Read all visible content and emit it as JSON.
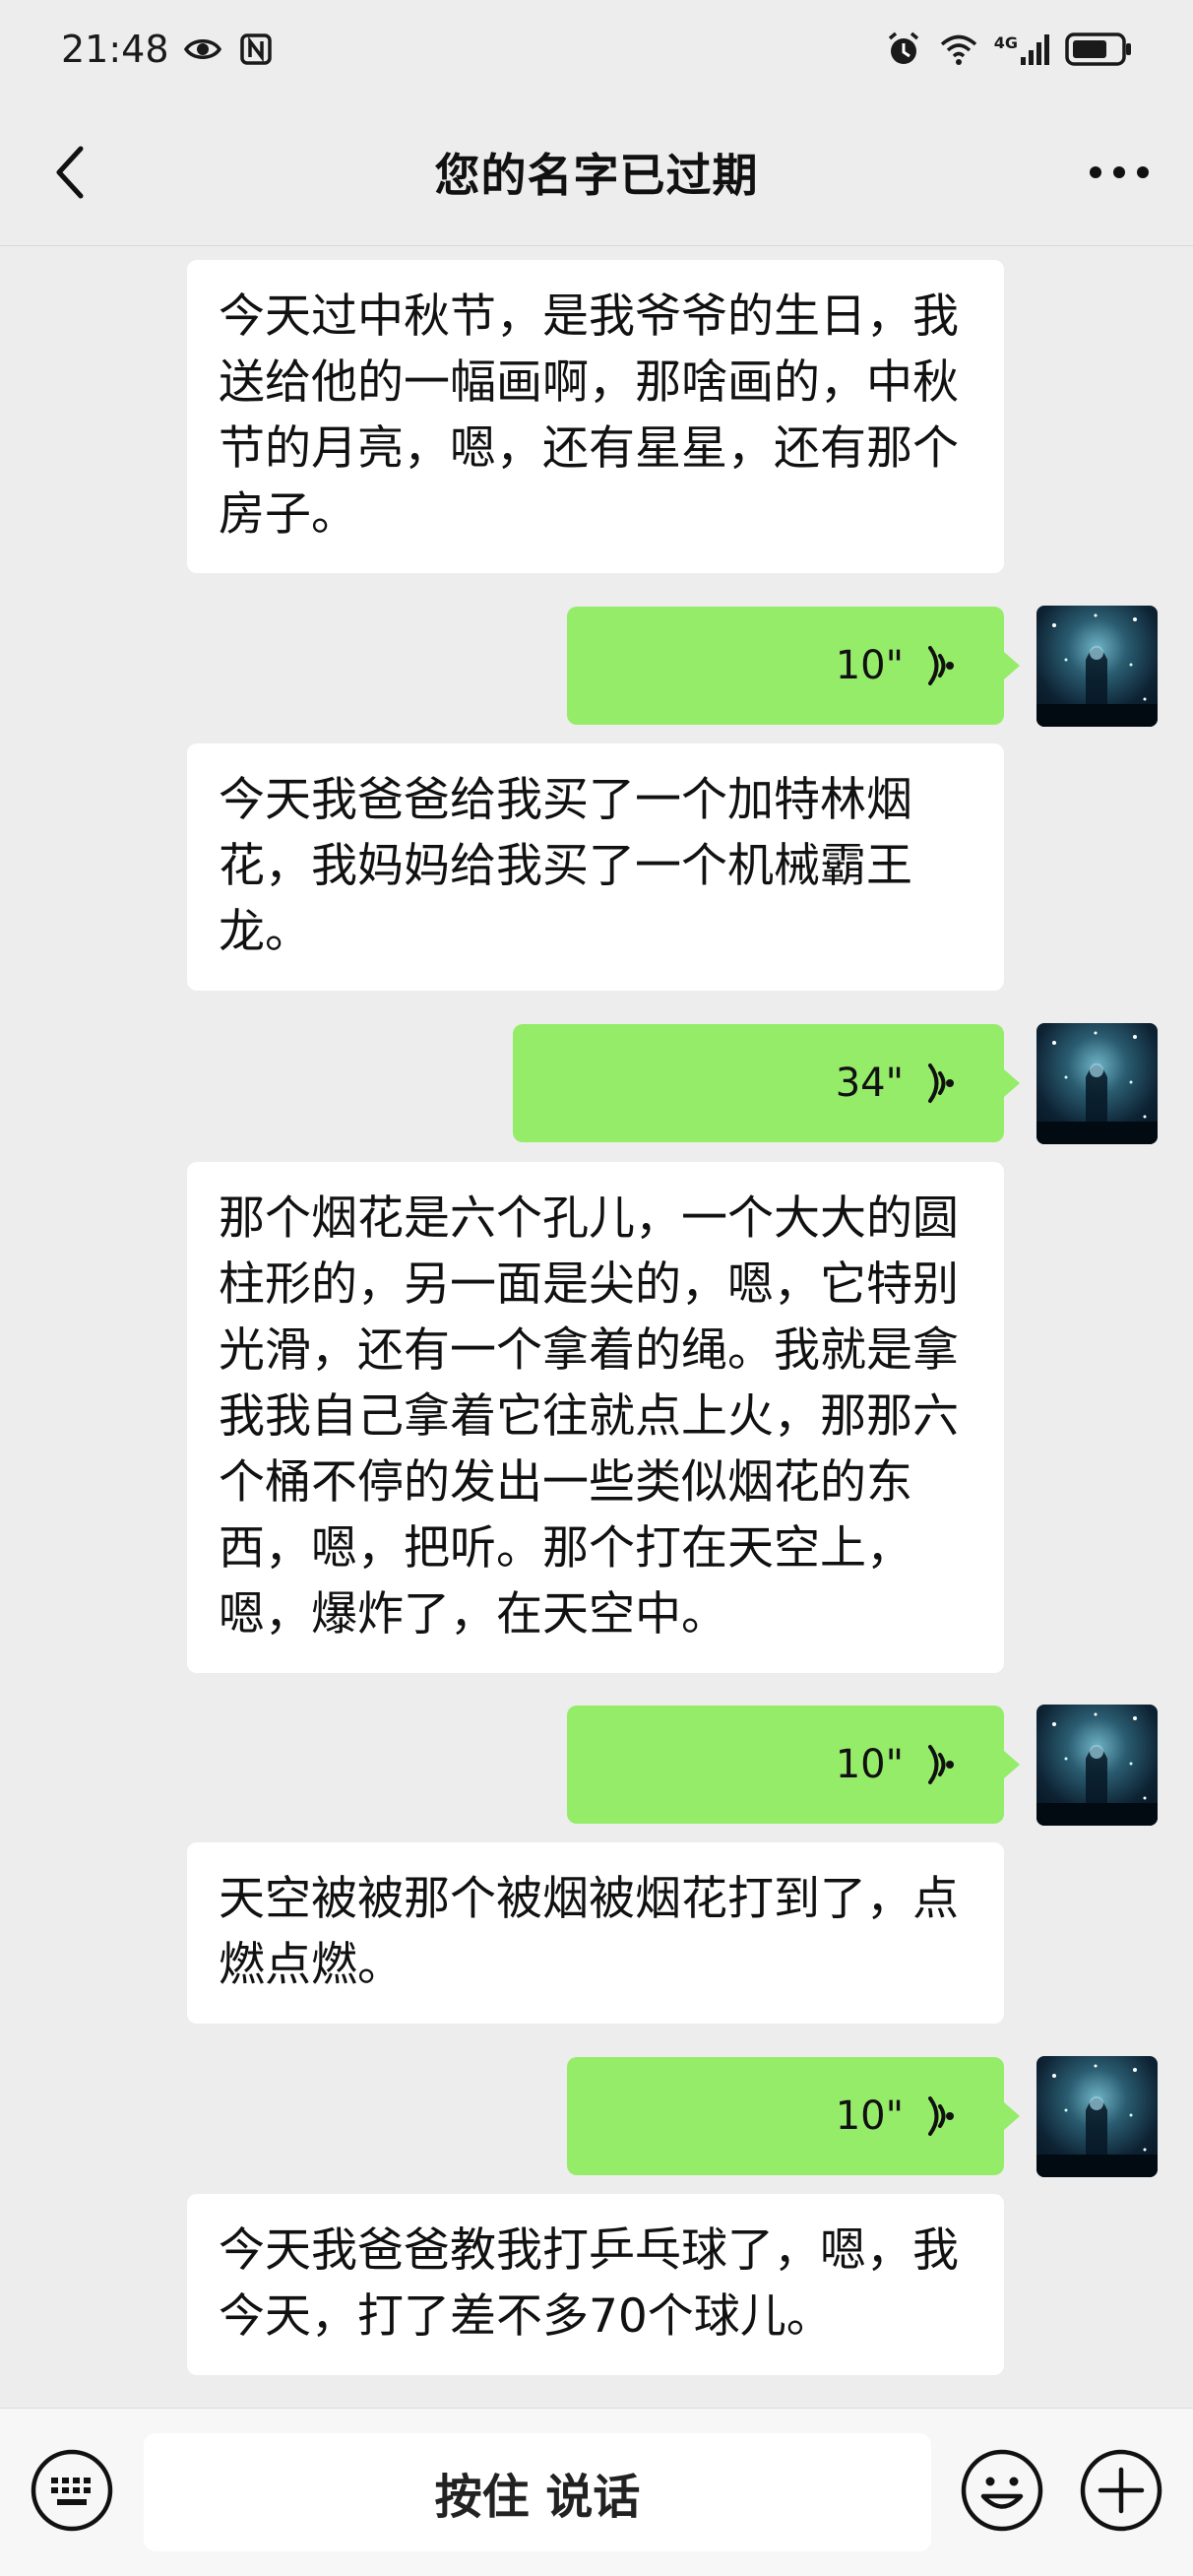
{
  "status_bar": {
    "time": "21:48",
    "network": "4G",
    "icons_left": [
      "eye-icon",
      "nfc-icon"
    ],
    "icons_right": [
      "alarm-icon",
      "wifi-icon",
      "signal-icon",
      "battery-icon"
    ]
  },
  "header": {
    "title": "您的名字已过期",
    "back_icon": "chevron-left-icon",
    "more_icon": "more-dots-icon"
  },
  "messages": [
    {
      "type": "text",
      "side": "left",
      "text": "今天过中秋节，是我爷爷的生日，我送给他的一幅画啊，那啥画的，中秋节的月亮，嗯，还有星星，还有那个房子。"
    },
    {
      "type": "voice",
      "side": "right",
      "duration": "10\""
    },
    {
      "type": "text",
      "side": "left",
      "text": "今天我爸爸给我买了一个加特林烟花，我妈妈给我买了一个机械霸王龙。"
    },
    {
      "type": "voice",
      "side": "right",
      "duration": "34\""
    },
    {
      "type": "text",
      "side": "left",
      "text": "那个烟花是六个孔儿，一个大大的圆柱形的，另一面是尖的，嗯，它特别光滑，还有一个拿着的绳。我就是拿我我自己拿着它往就点上火，那那六个桶不停的发出一些类似烟花的东西，嗯，把听。那个打在天空上，嗯，爆炸了，在天空中。"
    },
    {
      "type": "voice",
      "side": "right",
      "duration": "10\""
    },
    {
      "type": "text",
      "side": "left",
      "text": "天空被被那个被烟被烟花打到了，点燃点燃。"
    },
    {
      "type": "voice",
      "side": "right",
      "duration": "10\""
    },
    {
      "type": "text",
      "side": "left",
      "text": "今天我爸爸教我打乒乓球了，嗯，我今天，打了差不多70个球儿。"
    }
  ],
  "input_bar": {
    "talk_label": "按住 说话",
    "keyboard_icon": "keyboard-icon",
    "emoji_icon": "emoji-icon",
    "plus_icon": "plus-icon"
  },
  "colors": {
    "background": "#ededed",
    "voice_bubble": "#95ec69",
    "text_bubble": "#ffffff"
  }
}
